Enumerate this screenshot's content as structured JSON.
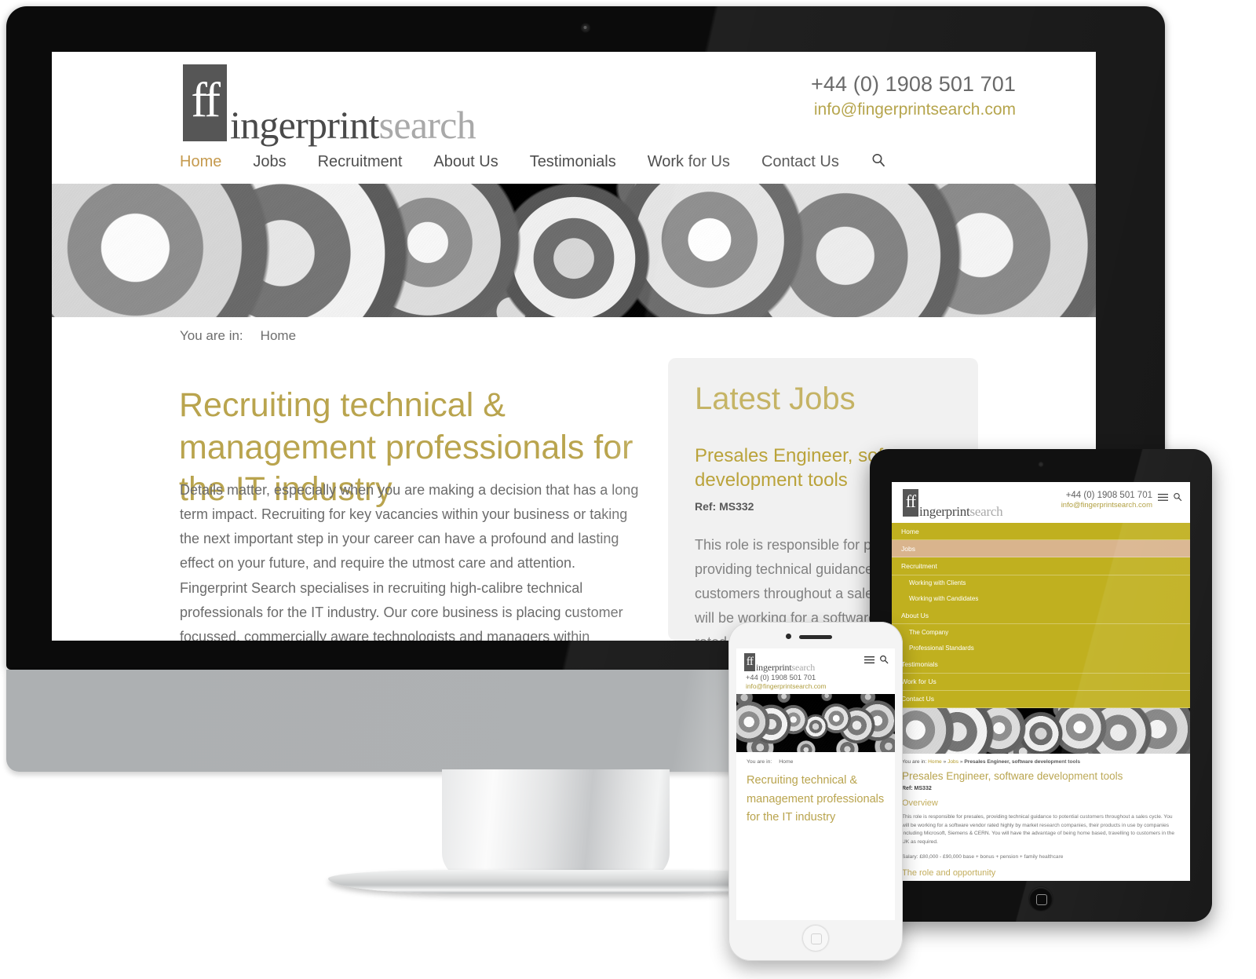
{
  "brand": {
    "logo_mark": "ff",
    "logo_word_dark": "ingerprint",
    "logo_word_light": "search",
    "accent_gold": "#b9a44e",
    "menu_gold": "#c0b01f",
    "active_nav": "#c59a4e"
  },
  "contact": {
    "phone": "+44 (0) 1908 501 701",
    "email": "info@fingerprintsearch.com"
  },
  "nav": {
    "items": [
      {
        "label": "Home",
        "active": true
      },
      {
        "label": "Jobs",
        "active": false
      },
      {
        "label": "Recruitment",
        "active": false
      },
      {
        "label": "About Us",
        "active": false
      },
      {
        "label": "Testimonials",
        "active": false
      },
      {
        "label": "Work for Us",
        "active": false
      },
      {
        "label": "Contact Us",
        "active": false
      }
    ],
    "search_icon": "search-icon"
  },
  "desktop": {
    "breadcrumb_label": "You are in:",
    "breadcrumb_current": "Home",
    "heading": "Recruiting technical & management professionals for the IT industry",
    "paragraph_1": "Details matter, especially when you are making a decision that has a long term impact. Recruiting for key vacancies within your business or taking the next important step in your career can have a profound and lasting effect on your future, and require the utmost care and attention.",
    "paragraph_2": "Fingerprint Search specialises in recruiting high-calibre technical professionals for the IT industry. Our core business is placing customer focussed, commercially aware technologists and managers within Technology Vendors, Service Providers and Systems Integrators. We particularly specialise in Presales consultants, Sales Engineers, Solutions",
    "jobs_panel": {
      "title": "Latest Jobs",
      "job_title": "Presales Engineer, software development tools",
      "job_ref": "Ref: MS332",
      "job_excerpt": "This role is responsible for presales, providing technical guidance to potential customers throughout a sales cycle. You will be working for a software vendor rated highly by ..."
    }
  },
  "tablet": {
    "menu": [
      {
        "label": "Home",
        "sub": false,
        "active": false
      },
      {
        "label": "Jobs",
        "sub": false,
        "active": true
      },
      {
        "label": "Recruitment",
        "sub": false,
        "active": false
      },
      {
        "label": "Working with Clients",
        "sub": true,
        "active": false
      },
      {
        "label": "Working with Candidates",
        "sub": true,
        "active": false
      },
      {
        "label": "About Us",
        "sub": false,
        "active": false
      },
      {
        "label": "The Company",
        "sub": true,
        "active": false
      },
      {
        "label": "Professional Standards",
        "sub": true,
        "active": false
      },
      {
        "label": "Testimonials",
        "sub": false,
        "active": false
      },
      {
        "label": "Work for Us",
        "sub": false,
        "active": false
      },
      {
        "label": "Contact Us",
        "sub": false,
        "active": false
      }
    ],
    "breadcrumb_label": "You are in:",
    "breadcrumb_home": "Home",
    "breadcrumb_jobs": "Jobs",
    "breadcrumb_current": "Presales Engineer, software development tools",
    "page_title": "Presales Engineer, software development tools",
    "ref": "Ref: MS332",
    "section_overview": "Overview",
    "overview_text": "This role is responsible for presales, providing technical guidance to potential customers throughout a sales cycle. You will be working for a software vendor rated highly by market research companies, their products in use by companies including Microsoft, Siemens & CERN. You will have the advantage of being home based, travelling to customers in the UK as required.",
    "salary": "Salary: £80,000 - £90,000 base + bonus + pension + family healthcare",
    "section_role": "The role and opportunity",
    "menu_icon": "hamburger-icon",
    "search_icon": "search-icon"
  },
  "phone": {
    "breadcrumb_label": "You are in:",
    "breadcrumb_current": "Home",
    "heading": "Recruiting technical & management professionals for the IT industry",
    "menu_icon": "hamburger-icon",
    "search_icon": "search-icon"
  }
}
